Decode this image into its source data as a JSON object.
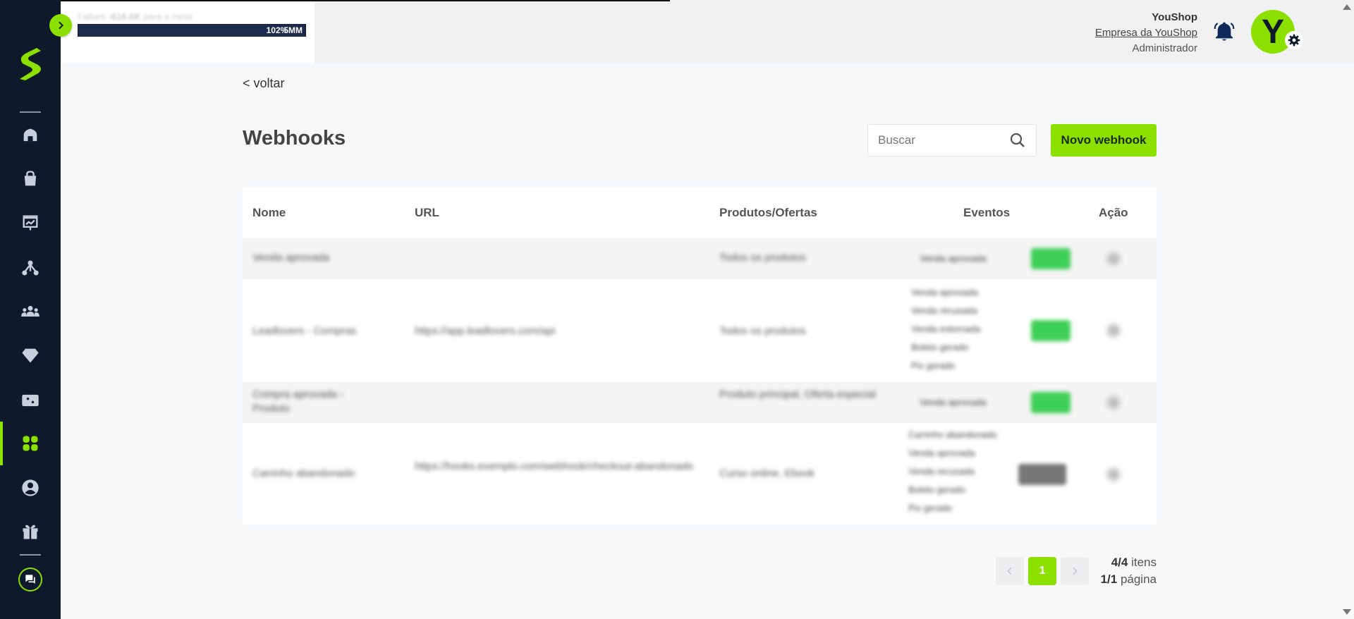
{
  "goal": {
    "text_prefix": "Faltam",
    "amount": "-616.6K",
    "text_suffix": "para a meta",
    "percent": "102%",
    "target": "5MM",
    "progress": 1.0
  },
  "user": {
    "name": "YouShop",
    "company": "Empresa da YouShop",
    "role": "Administrador",
    "avatar_letter": "Y"
  },
  "nav": {
    "back_label": "< voltar"
  },
  "page": {
    "title": "Webhooks"
  },
  "search": {
    "placeholder": "Buscar"
  },
  "actions": {
    "new_label": "Novo webhook"
  },
  "table": {
    "headers": {
      "name": "Nome",
      "url": "URL",
      "products": "Produtos/Ofertas",
      "events": "Eventos",
      "action": "Ação"
    },
    "rows": [
      {
        "name": "Venda aprovada",
        "url": "",
        "products": "Todos os produtos",
        "events": [
          "Venda aprovada"
        ],
        "enabled": true
      },
      {
        "name": "Leadlovers - Compras",
        "url": "https://app.leadlovers.com/api",
        "products": "Todos os produtos",
        "events": [
          "Venda aprovada",
          "Venda recusada",
          "Venda estornada",
          "Boleto gerado",
          "Pix gerado"
        ],
        "enabled": true
      },
      {
        "name": "Compra aprovada - Produto",
        "url": "",
        "products": "Produto principal, Oferta especial",
        "events": [
          "Venda aprovada"
        ],
        "enabled": true
      },
      {
        "name": "Carrinho abandonado",
        "url": "https://hooks.exemplo.com/webhook/checkout-abandonado",
        "products": "Curso online, Ebook",
        "events": [
          "Carrinho abandonado",
          "Venda aprovada",
          "Venda recusada",
          "Boleto gerado",
          "Pix gerado"
        ],
        "enabled": false
      }
    ]
  },
  "pagination": {
    "current_page": "1",
    "items_count": "4/4",
    "items_label": "itens",
    "pages_count": "1/1",
    "pages_label": "página"
  },
  "icons": {
    "logo": "brand-s-logo-icon",
    "home": "home-icon",
    "bag": "shopping-bag-icon",
    "chart": "presentation-chart-icon",
    "network": "affiliates-network-icon",
    "users": "users-icon",
    "diamond": "diamond-icon",
    "ticket": "ticket-icon",
    "apps": "apps-grid-icon",
    "account": "account-icon",
    "gift": "gift-icon",
    "chat": "chat-icon",
    "bell": "bell-icon",
    "gear": "gear-icon",
    "search": "search-icon"
  },
  "colors": {
    "accent": "#8ce000",
    "sidebar": "#0e1a2b",
    "toggle_on": "#3ecf57",
    "toggle_off": "#777777"
  }
}
